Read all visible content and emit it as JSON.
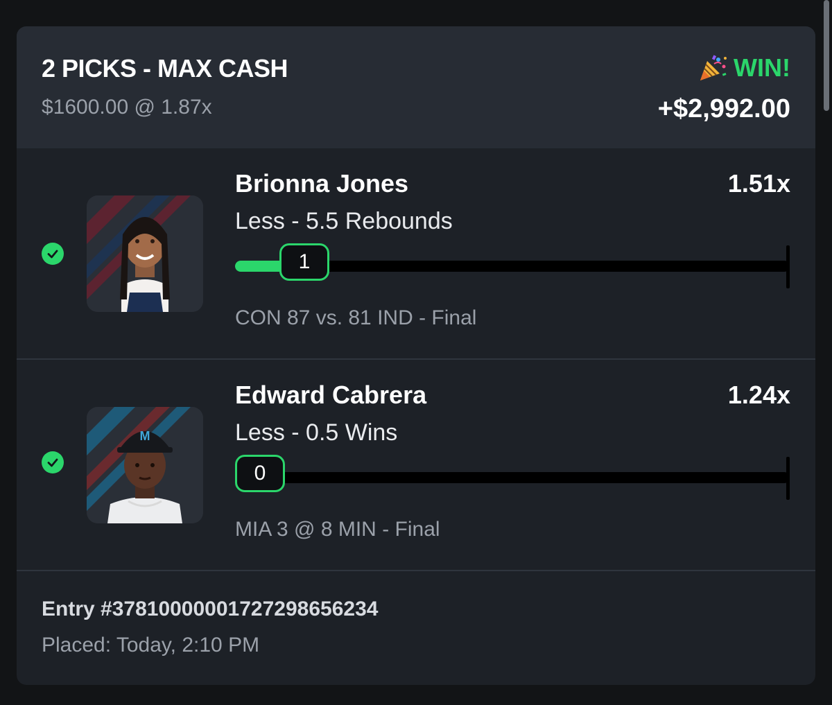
{
  "entry": {
    "title": "2 PICKS - MAX CASH",
    "stake": "$1600.00 @ 1.87x",
    "result_icon": "party-popper-icon",
    "result_label": "WIN!",
    "payout": "+$2,992.00",
    "number": "Entry #3781000000172729865623​4",
    "placed": "Placed: Today, 2:10 PM"
  },
  "picks": [
    {
      "status_icon": "check-circle-icon",
      "name": "Brionna Jones",
      "multiplier": "1.51x",
      "line": "Less - 5.5 Rebounds",
      "current_value": "1",
      "progress": 0.125,
      "game": "CON 87 vs. 81 IND",
      "game_status": "- Final"
    },
    {
      "status_icon": "check-circle-icon",
      "name": "Edward Cabrera",
      "multiplier": "1.24x",
      "line": "Less - 0.5 Wins",
      "current_value": "0",
      "progress": 0,
      "game": "MIA 3 @ 8 MIN",
      "game_status": "- Final"
    }
  ],
  "colors": {
    "accent_green": "#2bd66b",
    "card_bg": "#1d2127",
    "header_bg": "#272c34"
  }
}
